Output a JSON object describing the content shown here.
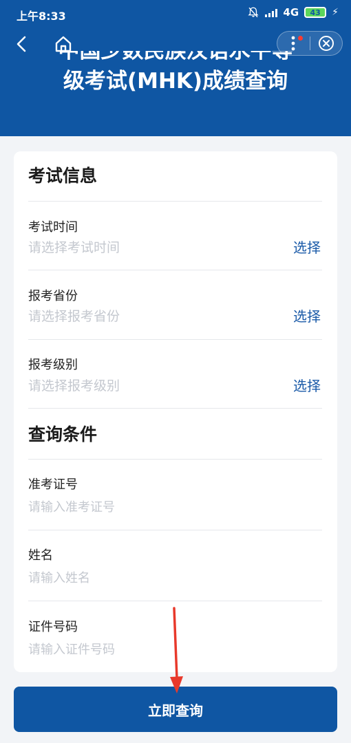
{
  "status_bar": {
    "time": "上午8:33",
    "network": "4G",
    "battery": "43"
  },
  "nav": {
    "back_icon": "chevron-left-icon",
    "home_icon": "home-icon",
    "more_icon": "more-vertical-icon",
    "close_icon": "close-circle-icon"
  },
  "page": {
    "title_line1": "中国少数民族汉语水平等",
    "title_line2": "级考试(MHK)成绩查询"
  },
  "exam_info": {
    "heading": "考试信息",
    "fields": [
      {
        "label": "考试时间",
        "placeholder": "请选择考试时间",
        "action": "选择"
      },
      {
        "label": "报考省份",
        "placeholder": "请选择报考省份",
        "action": "选择"
      },
      {
        "label": "报考级别",
        "placeholder": "请选择报考级别",
        "action": "选择"
      }
    ]
  },
  "query": {
    "heading": "查询条件",
    "fields": [
      {
        "label": "准考证号",
        "placeholder": "请输入准考证号"
      },
      {
        "label": "姓名",
        "placeholder": "请输入姓名"
      },
      {
        "label": "证件号码",
        "placeholder": "请输入证件号码"
      }
    ]
  },
  "submit": {
    "label": "立即查询"
  },
  "colors": {
    "brand": "#0f56a3",
    "link": "#1a5aa8",
    "placeholder": "#c4c8cf",
    "annotation_arrow": "#e8392b"
  }
}
